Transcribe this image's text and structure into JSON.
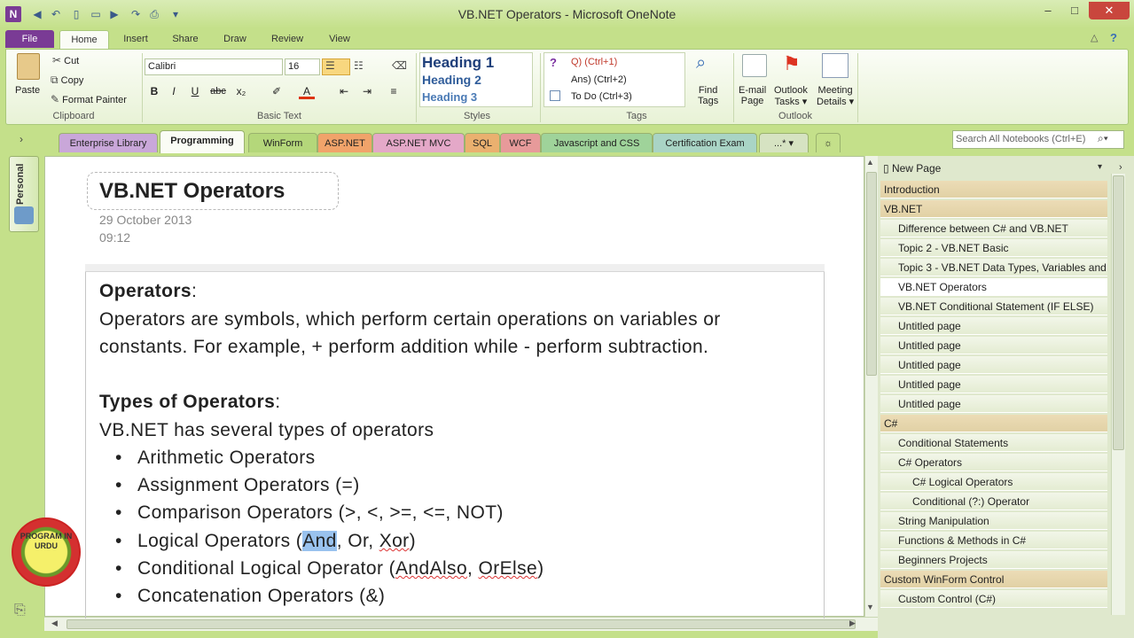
{
  "window": {
    "title": "VB.NET Operators  -  Microsoft OneNote",
    "app_icon": "N",
    "min": "–",
    "max": "□",
    "close": "✕"
  },
  "ribbon_tabs": [
    "File",
    "Home",
    "Insert",
    "Share",
    "Draw",
    "Review",
    "View"
  ],
  "clipboard": {
    "paste": "Paste",
    "cut": "Cut",
    "copy": "Copy",
    "format_painter": "Format Painter",
    "label": "Clipboard"
  },
  "basic_text": {
    "font": "Calibri",
    "size": "16",
    "label": "Basic Text",
    "buttons": [
      "B",
      "I",
      "U",
      "abc",
      "x₂"
    ]
  },
  "styles": {
    "items": [
      "Heading 1",
      "Heading 2",
      "Heading 3"
    ],
    "label": "Styles"
  },
  "tags": {
    "items": [
      "Q) (Ctrl+1)",
      "Ans) (Ctrl+2)",
      "To Do (Ctrl+3)"
    ],
    "find_tags": [
      "Find",
      "Tags"
    ],
    "label": "Tags"
  },
  "outlook": {
    "email": [
      "E-mail",
      "Page"
    ],
    "tasks": [
      "Outlook",
      "Tasks ▾"
    ],
    "meeting": [
      "Meeting",
      "Details ▾"
    ],
    "label": "Outlook"
  },
  "section_tabs": [
    {
      "label": "Enterprise Library",
      "color": "#c9a7d9"
    },
    {
      "label": "Programming",
      "color": "#fafcf5"
    },
    {
      "label": "WinForm",
      "color": "#b4d77a"
    },
    {
      "label": "ASP.NET",
      "color": "#f1a36a"
    },
    {
      "label": "ASP.NET MVC",
      "color": "#e4a8c8"
    },
    {
      "label": "SQL",
      "color": "#eab06f"
    },
    {
      "label": "WCF",
      "color": "#e79a9a"
    },
    {
      "label": "Javascript and CSS",
      "color": "#9fd39a"
    },
    {
      "label": "Certification Exam",
      "color": "#a9d4c5"
    },
    {
      "label": "...*",
      "color": "#d6e3c2"
    }
  ],
  "search": {
    "placeholder": "Search All Notebooks (Ctrl+E)"
  },
  "notebook": {
    "name": "Personal"
  },
  "page": {
    "title": "VB.NET Operators",
    "date": "29 October 2013",
    "time": "09:12",
    "heading1": "Operators",
    "para1_line1": "Operators are symbols, which perform certain operations on variables or",
    "para1_line2": "constants. For example, + perform addition while - perform subtraction.",
    "heading2": "Types of Operators",
    "intro": "VB.NET has several types of operators",
    "bullets": {
      "b1": "Arithmetic Operators",
      "b2": "Assignment Operators (=)",
      "b3": "Comparison Operators (>, <, >=, <=, NOT)",
      "b4_pre": "Logical Operators (",
      "b4_sel": "And",
      "b4_mid": ", Or, ",
      "b4_xor": "Xor",
      "b4_end": ")",
      "b5_pre": "Conditional Logical Operator (",
      "b5_a": "AndAlso",
      "b5_mid": ", ",
      "b5_b": "OrElse",
      "b5_end": ")",
      "b6": "Concatenation Operators (&)"
    },
    "colon": ":",
    "bullet_char": "•"
  },
  "page_list": {
    "new_page": "New Page",
    "items": [
      {
        "label": "Introduction",
        "level": 0
      },
      {
        "label": "VB.NET",
        "level": 0
      },
      {
        "label": "Difference between C# and VB.NET",
        "level": 1
      },
      {
        "label": "Topic 2 - VB.NET Basic",
        "level": 1
      },
      {
        "label": "Topic 3 - VB.NET Data Types, Variables and",
        "level": 1
      },
      {
        "label": "VB.NET Operators",
        "level": 1,
        "selected": true
      },
      {
        "label": "VB.NET Conditional Statement (IF ELSE)",
        "level": 1
      },
      {
        "label": "Untitled page",
        "level": 1
      },
      {
        "label": "Untitled page",
        "level": 1
      },
      {
        "label": "Untitled page",
        "level": 1
      },
      {
        "label": "Untitled page",
        "level": 1
      },
      {
        "label": "Untitled page",
        "level": 1
      },
      {
        "label": "C#",
        "level": 0
      },
      {
        "label": "Conditional Statements",
        "level": 1
      },
      {
        "label": "C# Operators",
        "level": 1
      },
      {
        "label": "C# Logical Operators",
        "level": 2
      },
      {
        "label": "Conditional (?:) Operator",
        "level": 2
      },
      {
        "label": "String Manipulation",
        "level": 1
      },
      {
        "label": "Functions & Methods in C#",
        "level": 1
      },
      {
        "label": "Beginners Projects",
        "level": 1
      },
      {
        "label": "Custom WinForm Control",
        "level": 0
      },
      {
        "label": "Custom Control (C#)",
        "level": 1
      }
    ]
  },
  "badge": {
    "text": "PROGRAM IN URDU"
  }
}
